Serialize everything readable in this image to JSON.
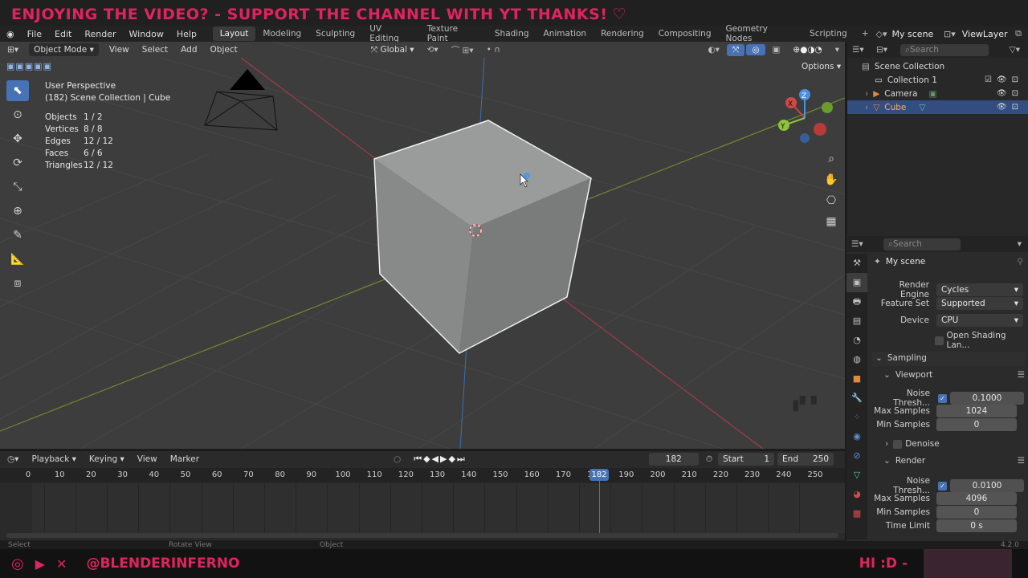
{
  "banner": {
    "text": "ENJOYING THE VIDEO?   -   SUPPORT THE CHANNEL WITH YT THANKS!",
    "heart_icon": "heart-icon"
  },
  "menubar": {
    "items": [
      "File",
      "Edit",
      "Render",
      "Window",
      "Help"
    ]
  },
  "workspaces": {
    "tabs": [
      "Layout",
      "Modeling",
      "Sculpting",
      "UV Editing",
      "Texture Paint",
      "Shading",
      "Animation",
      "Rendering",
      "Compositing",
      "Geometry Nodes",
      "Scripting"
    ],
    "active": "Layout",
    "add": "+"
  },
  "scene": {
    "name": "My scene",
    "view_layer": "ViewLayer"
  },
  "viewport": {
    "mode": "Object Mode",
    "menus": [
      "View",
      "Select",
      "Add",
      "Object"
    ],
    "transform": "Global",
    "options": "Options",
    "perspective": "User Perspective",
    "collection_line": "(182) Scene Collection | Cube",
    "stats": [
      {
        "label": "Objects",
        "value": "1 / 2"
      },
      {
        "label": "Vertices",
        "value": "8 / 8"
      },
      {
        "label": "Edges",
        "value": "12 / 12"
      },
      {
        "label": "Faces",
        "value": "6 / 6"
      },
      {
        "label": "Triangles",
        "value": "12 / 12"
      }
    ],
    "gizmo": {
      "x": "X",
      "y": "Y",
      "z": "Z"
    }
  },
  "outliner": {
    "search_placeholder": "Search",
    "root": "Scene Collection",
    "items": [
      {
        "label": "Collection 1"
      },
      {
        "label": "Camera"
      },
      {
        "label": "Cube",
        "selected": true
      }
    ]
  },
  "properties": {
    "search_placeholder": "Search",
    "scene_name": "My scene",
    "render_engine": {
      "label": "Render Engine",
      "value": "Cycles"
    },
    "feature_set": {
      "label": "Feature Set",
      "value": "Supported"
    },
    "device": {
      "label": "Device",
      "value": "CPU"
    },
    "osl": {
      "label": "Open Shading Lan..."
    },
    "sampling": "Sampling",
    "viewport_section": "Viewport",
    "vp_noise": {
      "label": "Noise Thresh...",
      "value": "0.1000"
    },
    "vp_max": {
      "label": "Max Samples",
      "value": "1024"
    },
    "vp_min": {
      "label": "Min Samples",
      "value": "0"
    },
    "denoise": "Denoise",
    "render_section": "Render",
    "r_noise": {
      "label": "Noise Thresh...",
      "value": "0.0100"
    },
    "r_max": {
      "label": "Max Samples",
      "value": "4096"
    },
    "r_min": {
      "label": "Min Samples",
      "value": "0"
    },
    "r_time": {
      "label": "Time Limit",
      "value": "0 s"
    }
  },
  "timeline": {
    "menus": [
      "Playback",
      "Keying",
      "View",
      "Marker"
    ],
    "current_frame": "182",
    "start_label": "Start",
    "start": "1",
    "end_label": "End",
    "end": "250",
    "ticks": [
      "0",
      "10",
      "20",
      "30",
      "40",
      "50",
      "60",
      "70",
      "80",
      "90",
      "100",
      "110",
      "120",
      "130",
      "140",
      "150",
      "160",
      "170",
      "180",
      "190",
      "200",
      "210",
      "220",
      "230",
      "240",
      "250"
    ]
  },
  "statusbar": {
    "select": "Select",
    "rotate": "Rotate View",
    "object": "Object",
    "version": "4.2.0"
  },
  "social": {
    "handle": "@BLENDERINFERNO",
    "greeting": "HI :D -"
  },
  "colors": {
    "accent": "#4772b3",
    "brand": "#e0245e",
    "selection": "#334d80"
  }
}
